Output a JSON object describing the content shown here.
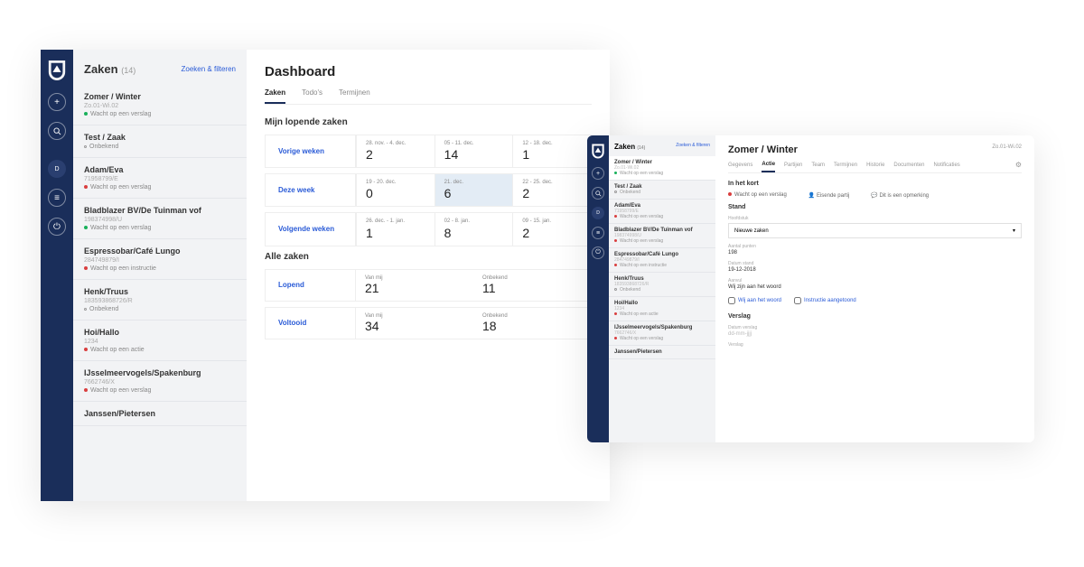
{
  "colors": {
    "navy": "#1a2e5a",
    "link": "#2a5bd7",
    "red": "#d93e3e",
    "green": "#18b05a"
  },
  "sidebar": {
    "title": "Zaken",
    "count": "(14)",
    "filter_link": "Zoeken & filteren",
    "cases": [
      {
        "name": "Zomer / Winter",
        "sub": "Zo.01-Wi.02",
        "status": "Wacht op een verslag",
        "dot": "green"
      },
      {
        "name": "Test / Zaak",
        "sub": "",
        "status": "Onbekend",
        "dot": "gray"
      },
      {
        "name": "Adam/Eva",
        "sub": "71958799/E",
        "status": "Wacht op een verslag",
        "dot": "red"
      },
      {
        "name": "Bladblazer BV/De Tuinman vof",
        "sub": "198374998/U",
        "status": "Wacht op een verslag",
        "dot": "green"
      },
      {
        "name": "Espressobar/Café Lungo",
        "sub": "284749879/I",
        "status": "Wacht op een instructie",
        "dot": "red"
      },
      {
        "name": "Henk/Truus",
        "sub": "183593868726/R",
        "status": "Onbekend",
        "dot": "gray"
      },
      {
        "name": "Hoi/Hallo",
        "sub": "1234",
        "status": "Wacht op een actie",
        "dot": "red"
      },
      {
        "name": "IJsselmeervogels/Spakenburg",
        "sub": "7662746/X",
        "status": "Wacht op een verslag",
        "dot": "red"
      },
      {
        "name": "Janssen/Pietersen",
        "sub": "",
        "status": "",
        "dot": ""
      }
    ]
  },
  "dashboard": {
    "title": "Dashboard",
    "tabs": [
      "Zaken",
      "Todo's",
      "Termijnen"
    ],
    "section1": "Mijn lopende zaken",
    "weeks": [
      {
        "label": "Vorige weken",
        "cells": [
          {
            "lbl": "28. nov. - 4. dec.",
            "num": "2"
          },
          {
            "lbl": "05 - 11. dec.",
            "num": "14"
          },
          {
            "lbl": "12 - 18. dec.",
            "num": "1"
          }
        ]
      },
      {
        "label": "Deze week",
        "cells": [
          {
            "lbl": "19 - 20. dec.",
            "num": "0"
          },
          {
            "lbl": "21. dec.",
            "num": "6",
            "hl": true
          },
          {
            "lbl": "22 - 25. dec.",
            "num": "2"
          }
        ]
      },
      {
        "label": "Volgende weken",
        "cells": [
          {
            "lbl": "26. dec. - 1. jan.",
            "num": "1"
          },
          {
            "lbl": "02 - 8. jan.",
            "num": "8"
          },
          {
            "lbl": "09 - 15. jan.",
            "num": "2"
          }
        ]
      }
    ],
    "section2": "Alle zaken",
    "stats": [
      {
        "label": "Lopend",
        "cells": [
          {
            "lbl": "Van mij",
            "num": "21"
          },
          {
            "lbl": "Onbekend",
            "num": "11"
          }
        ]
      },
      {
        "label": "Voltooid",
        "cells": [
          {
            "lbl": "Van mij",
            "num": "34"
          },
          {
            "lbl": "Onbekend",
            "num": "18"
          }
        ]
      }
    ]
  },
  "detail": {
    "sidebar_cases": [
      {
        "name": "Zomer / Winter",
        "sub": "Zo.01-Wi.02",
        "status": "Wacht op een verslag",
        "dot": "green",
        "active": true
      },
      {
        "name": "Test / Zaak",
        "sub": "",
        "status": "Onbekend",
        "dot": "gray"
      },
      {
        "name": "Adam/Eva",
        "sub": "71958799/E",
        "status": "Wacht op een verslag",
        "dot": "red"
      },
      {
        "name": "Bladblazer BV/De Tuinman vof",
        "sub": "198374998/U",
        "status": "Wacht op een verslag",
        "dot": "red"
      },
      {
        "name": "Espressobar/Café Lungo",
        "sub": "284749879/I",
        "status": "Wacht op een instructie",
        "dot": "red"
      },
      {
        "name": "Henk/Truus",
        "sub": "183593868726/R",
        "status": "Onbekend",
        "dot": "gray"
      },
      {
        "name": "Hoi/Hallo",
        "sub": "1234",
        "status": "Wacht op een actie",
        "dot": "red"
      },
      {
        "name": "IJsselmeervogels/Spakenburg",
        "sub": "7662746/X",
        "status": "Wacht op een verslag",
        "dot": "red"
      },
      {
        "name": "Janssen/Pietersen",
        "sub": "",
        "status": "",
        "dot": ""
      }
    ],
    "title": "Zomer / Winter",
    "ref": "Zo.01-Wi.02",
    "tabs": [
      "Gegevens",
      "Actie",
      "Partijen",
      "Team",
      "Termijnen",
      "Historie",
      "Documenten",
      "Notificaties"
    ],
    "active_tab": "Actie",
    "section_title": "In het kort",
    "summary": [
      {
        "label": "Wacht op een verslag",
        "type": "r"
      },
      {
        "label": "Eisende partij",
        "type": "user"
      },
      {
        "label": "Dit is een opmerking",
        "type": "comment"
      }
    ],
    "stand_title": "Stand",
    "hoofdstuk_label": "Hoofdstuk",
    "hoofdstuk_value": "Nieuwe zaken",
    "punten_label": "Aantal punten",
    "punten_value": "198",
    "datum_label": "Datum stand",
    "datum_value": "19-12-2018",
    "aanvul_label": "Aanvul",
    "aanvul_value": "Wij zijn aan het woord",
    "checkboxes": [
      "Wij aan het woord",
      "Instructie aangetoond"
    ],
    "verslag_title": "Verslag",
    "verslag_datum_label": "Datum verslag",
    "verslag_datum_value": "dd-mm-jjjj",
    "verslag_field": "Verslag"
  }
}
